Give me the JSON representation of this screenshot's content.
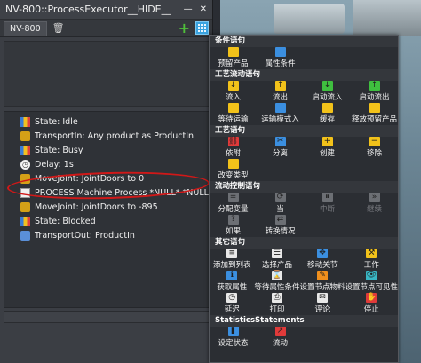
{
  "window": {
    "title": "NV-800::ProcessExecutor__HIDE__",
    "tab": "NV-800",
    "icons": [
      "trash-icon",
      "plus-icon",
      "grid-icon"
    ]
  },
  "execution_list": [
    {
      "text": "State: Idle",
      "icon": "state-bar-icon"
    },
    {
      "text": "TransportIn: Any product as ProductIn",
      "icon": "transport-in-icon"
    },
    {
      "text": "State: Busy",
      "icon": "state-bar-icon"
    },
    {
      "text": "Delay: 1s",
      "icon": "clock-icon"
    },
    {
      "text": "MoveJoint: JointDoors to 0",
      "icon": "move-joint-icon"
    },
    {
      "text": "PROCESS Machine Process *NULL* *NULL*",
      "icon": "process-icon"
    },
    {
      "text": "MoveJoint: JointDoors to -895",
      "icon": "move-joint-icon"
    },
    {
      "text": "State: Blocked",
      "icon": "state-bar-icon"
    },
    {
      "text": "TransportOut: ProductIn",
      "icon": "transport-out-icon"
    }
  ],
  "menu": {
    "sections": [
      {
        "title": "条件语句",
        "items": [
          {
            "label": "预留产品",
            "icon": "reserve-product-icon",
            "color": "#f2c21a",
            "disabled": false
          },
          {
            "label": "属性条件",
            "icon": "property-condition-icon",
            "color": "#3b8fe0",
            "disabled": false
          }
        ]
      },
      {
        "title": "工艺流动语句",
        "items": [
          {
            "label": "流入",
            "icon": "flow-in-icon",
            "color": "#f2c21a",
            "disabled": false
          },
          {
            "label": "流出",
            "icon": "flow-out-icon",
            "color": "#f2c21a",
            "disabled": false
          },
          {
            "label": "启动流入",
            "icon": "start-flow-in-icon",
            "color": "#3fbf3f",
            "disabled": false
          },
          {
            "label": "启动流出",
            "icon": "start-flow-out-icon",
            "color": "#3fbf3f",
            "disabled": false
          },
          {
            "label": "等待运输",
            "icon": "wait-transport-icon",
            "color": "#f2c21a",
            "disabled": false
          },
          {
            "label": "运输模式入",
            "icon": "transport-mode-in-icon",
            "color": "#3b8fe0",
            "disabled": false
          },
          {
            "label": "缓存",
            "icon": "buffer-icon",
            "color": "#f2c21a",
            "disabled": false
          },
          {
            "label": "释放预留产品",
            "icon": "release-reserved-icon",
            "color": "#f2c21a",
            "disabled": false
          }
        ]
      },
      {
        "title": "工艺语句",
        "items": [
          {
            "label": "依附",
            "icon": "attach-icon",
            "color": "#e03a3a",
            "disabled": false
          },
          {
            "label": "分离",
            "icon": "detach-icon",
            "color": "#3b8fe0",
            "disabled": false
          },
          {
            "label": "创建",
            "icon": "create-icon",
            "color": "#f2c21a",
            "disabled": false
          },
          {
            "label": "移除",
            "icon": "remove-icon",
            "color": "#f2c21a",
            "disabled": false
          },
          {
            "label": "改变类型",
            "icon": "change-type-icon",
            "color": "#f2c21a",
            "disabled": false
          }
        ]
      },
      {
        "title": "流动控制语句",
        "items": [
          {
            "label": "分配变量",
            "icon": "assign-variable-icon",
            "color": "#6c6f74",
            "disabled": false
          },
          {
            "label": "当",
            "icon": "while-icon",
            "color": "#6c6f74",
            "disabled": false
          },
          {
            "label": "中断",
            "icon": "break-icon",
            "color": "#6c6f74",
            "disabled": true
          },
          {
            "label": "继续",
            "icon": "continue-icon",
            "color": "#6c6f74",
            "disabled": true
          },
          {
            "label": "如果",
            "icon": "if-icon",
            "color": "#6c6f74",
            "disabled": false
          },
          {
            "label": "转换情况",
            "icon": "switch-case-icon",
            "color": "#6c6f74",
            "disabled": false
          }
        ]
      },
      {
        "title": "其它语句",
        "items": [
          {
            "label": "添加到列表",
            "icon": "add-to-list-icon",
            "color": "#e8e8e8",
            "disabled": false
          },
          {
            "label": "选择产品",
            "icon": "select-product-icon",
            "color": "#e8e8e8",
            "disabled": false
          },
          {
            "label": "移动关节",
            "icon": "move-joint-icon",
            "color": "#3b8fe0",
            "disabled": false
          },
          {
            "label": "工作",
            "icon": "work-icon",
            "color": "#f2c21a",
            "disabled": false
          },
          {
            "label": "获取属性",
            "icon": "get-property-icon",
            "color": "#3b8fe0",
            "disabled": false
          },
          {
            "label": "等待属性条件",
            "icon": "wait-property-icon",
            "color": "#e8e8e8",
            "disabled": false
          },
          {
            "label": "设置节点物料",
            "icon": "set-node-material-icon",
            "color": "#ef8f1d",
            "disabled": false
          },
          {
            "label": "设置节点可见性",
            "icon": "set-node-visibility-icon",
            "color": "#39b6c4",
            "disabled": false
          },
          {
            "label": "延迟",
            "icon": "delay-icon",
            "color": "#e8e8e8",
            "disabled": false
          },
          {
            "label": "打印",
            "icon": "print-icon",
            "color": "#e8e8e8",
            "disabled": false
          },
          {
            "label": "评论",
            "icon": "comment-icon",
            "color": "#e8e8e8",
            "disabled": false
          },
          {
            "label": "停止",
            "icon": "stop-icon",
            "color": "#e03a3a",
            "disabled": false
          }
        ]
      },
      {
        "title": "StatisticsStatements",
        "items": [
          {
            "label": "设定状态",
            "icon": "set-state-icon",
            "color": "#3b8fe0",
            "disabled": false
          },
          {
            "label": "流动",
            "icon": "flow-icon",
            "color": "#e03a3a",
            "disabled": false
          }
        ]
      }
    ]
  }
}
